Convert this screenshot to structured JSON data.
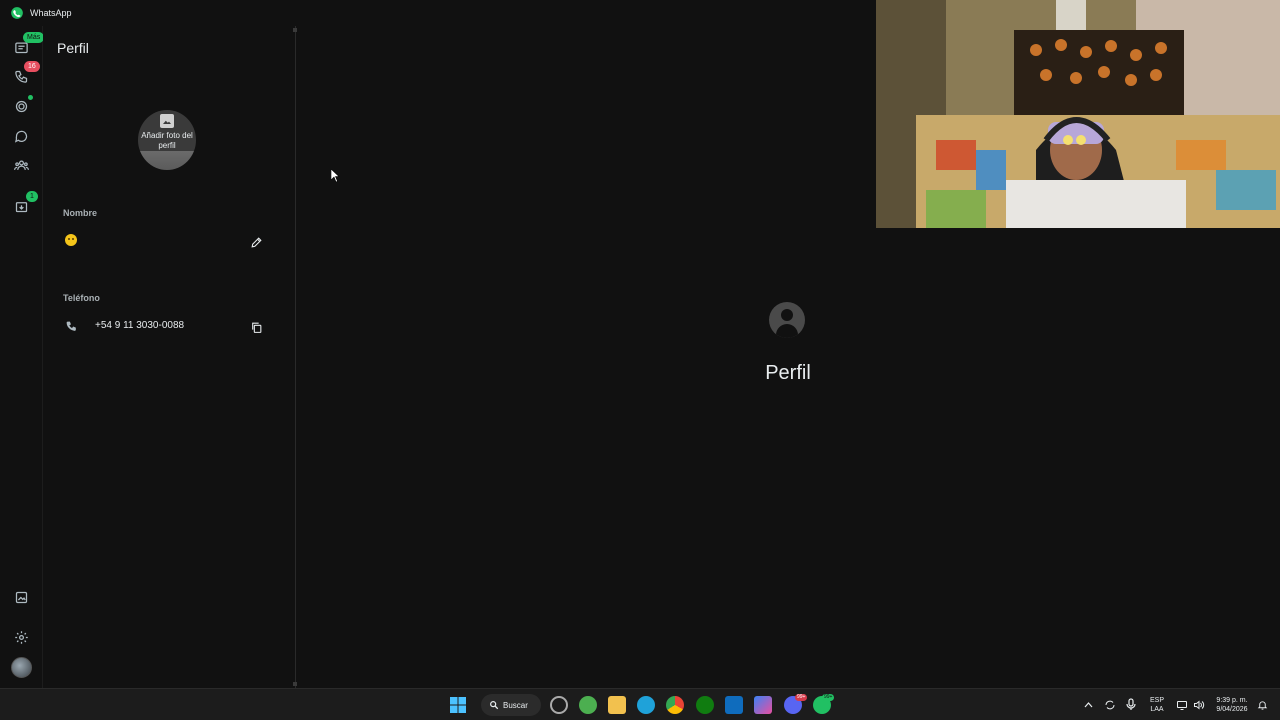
{
  "app": {
    "title": "WhatsApp"
  },
  "rail": {
    "chats_badge": "Más",
    "calls_badge": "16",
    "archived_badge": "1"
  },
  "profile_panel": {
    "title": "Perfil",
    "photo_label": "Añadir foto del perfil",
    "name_label": "Nombre",
    "phone_label": "Teléfono",
    "phone_number": "+54 9 11 3030-0088"
  },
  "main": {
    "title": "Perfil"
  },
  "taskbar": {
    "search_label": "Buscar",
    "lang_top": "ESP",
    "lang_bottom": "LAA",
    "time": "9:39 p. m.",
    "date": "9/04/2026",
    "discord_badge": "99+",
    "whatsapp_badge": "99+"
  },
  "colors": {
    "accent": "#21c063",
    "badge_red": "#e84f60",
    "background": "#111111"
  }
}
